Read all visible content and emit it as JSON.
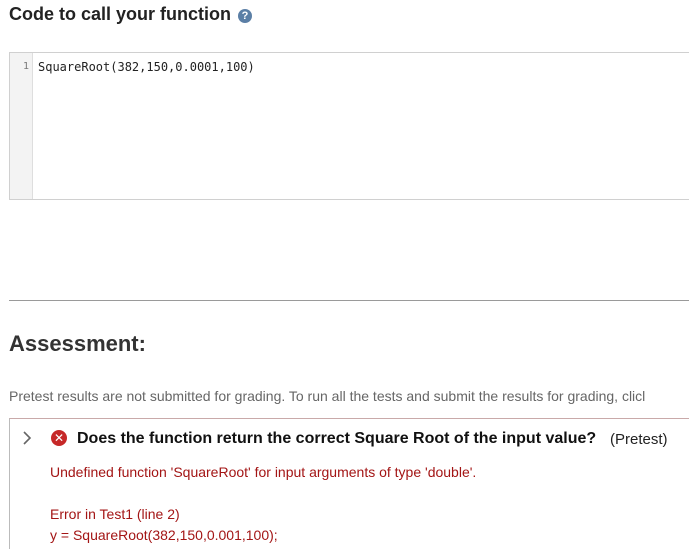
{
  "code_section": {
    "title": "Code to call your function",
    "help_icon": "question-icon",
    "editor": {
      "line_number": "1",
      "code": "SquareRoot(382,150,0.0001,100)"
    }
  },
  "assessment": {
    "title": "Assessment:",
    "note": "Pretest results are not submitted for grading. To run all the tests and submit the results for grading, clicl",
    "test": {
      "expand_icon": "chevron-right-icon",
      "status_icon": "error-x-icon",
      "status_color": "#c62828",
      "title": "Does the function return the correct Square Root of the input value?",
      "tag": "(Pretest)",
      "messages": {
        "error_message": "Undefined function 'SquareRoot' for input arguments of type 'double'.",
        "error_location": "Error in Test1 (line 2)",
        "error_code": "y = SquareRoot(382,150,0.001,100);"
      }
    }
  }
}
